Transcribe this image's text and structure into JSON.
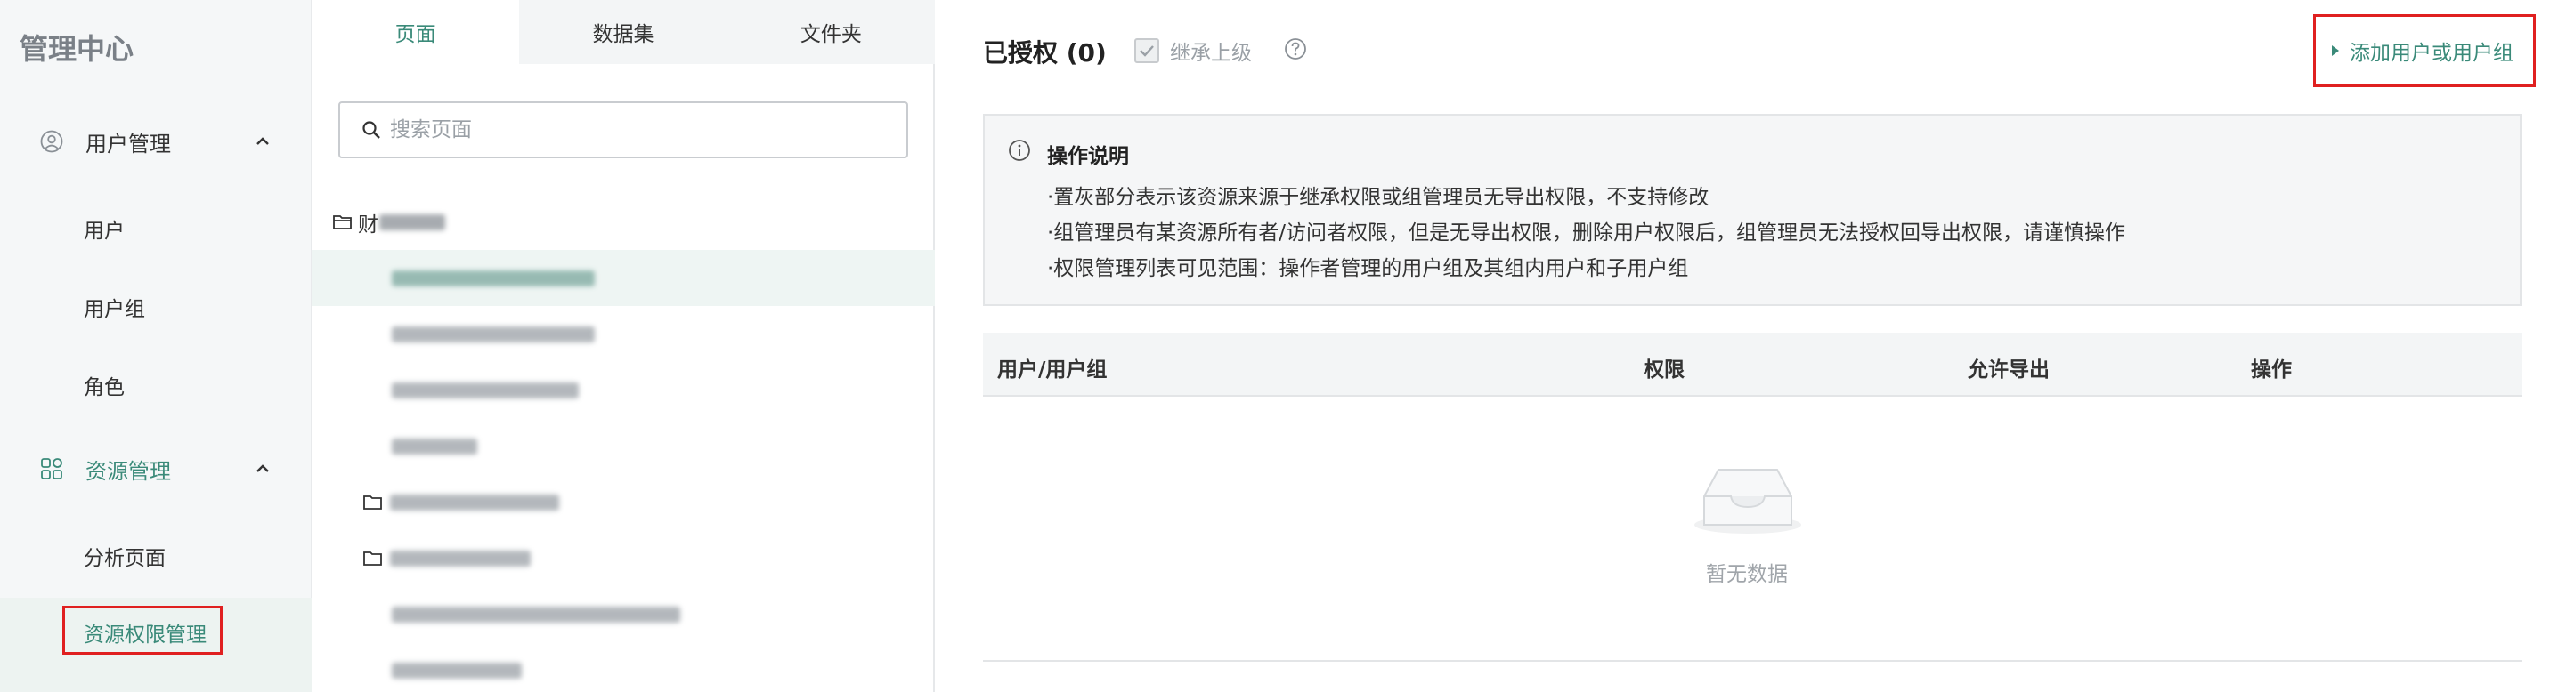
{
  "sidebar": {
    "title": "管理中心",
    "groups": [
      {
        "label": "用户管理",
        "icon": "user-circle-icon",
        "items": [
          "用户",
          "用户组",
          "角色"
        ]
      },
      {
        "label": "资源管理",
        "icon": "grid-icon",
        "items": [
          "分析页面",
          "资源权限管理"
        ]
      }
    ],
    "active_item": "资源权限管理"
  },
  "middle": {
    "tabs": [
      "页面",
      "数据集",
      "文件夹"
    ],
    "active_tab": "页面",
    "search_placeholder": "搜索页面",
    "tree_root_label": "财"
  },
  "main": {
    "auth_title": "已授权 (0)",
    "inherit_label": "继承上级",
    "add_button_label": "添加用户或用户组",
    "notice": {
      "title": "操作说明",
      "lines": [
        "·置灰部分表示该资源来源于继承权限或组管理员无导出权限，不支持修改",
        "·组管理员有某资源所有者/访问者权限，但是无导出权限，删除用户权限后，组管理员无法授权回导出权限，请谨慎操作",
        "·权限管理列表可见范围：操作者管理的用户组及其组内用户和子用户组"
      ]
    },
    "table": {
      "headers": [
        "用户/用户组",
        "权限",
        "允许导出",
        "操作"
      ],
      "empty_text": "暂无数据"
    }
  },
  "colors": {
    "accent": "#3a8a79",
    "highlight_border": "#e02020",
    "sidebar_bg": "#f5f7f8"
  }
}
